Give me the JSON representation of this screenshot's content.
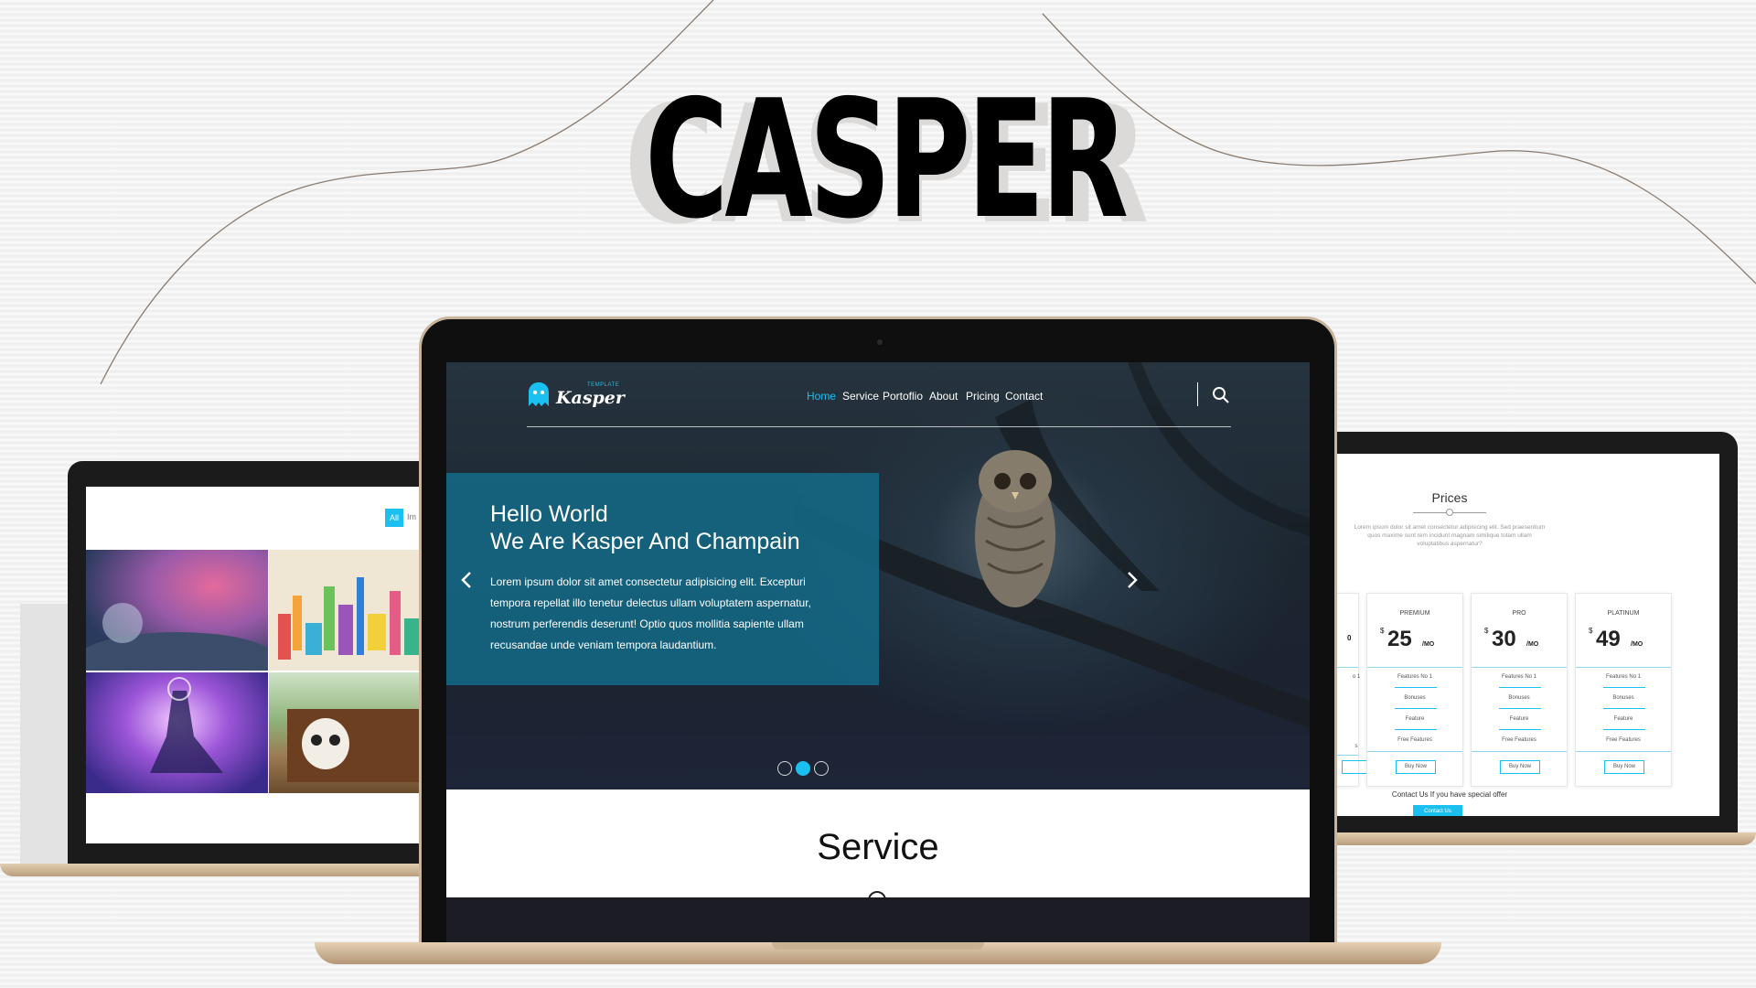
{
  "poster": {
    "title": "CASPER"
  },
  "left_screen": {
    "filter_active": "All",
    "filter_next": "Im"
  },
  "hero": {
    "logo_text": "Kasper",
    "logo_sub": "TEMPLATE",
    "nav": [
      "Home",
      "Service",
      "Portoflio",
      "About",
      "Pricing",
      "Contact"
    ],
    "heading_line1": "Hello World",
    "heading_line2": "We Are Kasper And Champain",
    "paragraph": "Lorem ipsum dolor sit amet consectetur adipisicing elit. Excepturi tempora repellat illo tenetur delectus ullam voluptatem aspernatur, nostrum perferendis deserunt! Optio quos mollitia sapiente ullam recusandae unde veniam tempora laudantium.",
    "slide_count": 3,
    "active_slide": 2,
    "next_section": "Service"
  },
  "prices": {
    "title": "Prices",
    "description": "Lorem ipsum dolor sit amet consectetur adipisicing elit. Sed praesentium quos maxime sunt rem incidunt magnam similique totam ullam voluptatibus aspernatur?",
    "partial_card": {
      "price_fragment": "0",
      "features_fragment": [
        "o 1",
        "s"
      ]
    },
    "plans": [
      {
        "name": "PREMIUM",
        "currency": "$",
        "price": "25",
        "period": "/MO",
        "features": [
          "Features No 1",
          "Bonuses",
          "Feature",
          "Free Features"
        ],
        "button": "Buy Now"
      },
      {
        "name": "PRO",
        "currency": "$",
        "price": "30",
        "period": "/MO",
        "features": [
          "Features No 1",
          "Bonuses",
          "Feature",
          "Free Features"
        ],
        "button": "Buy Now"
      },
      {
        "name": "PLATINUM",
        "currency": "$",
        "price": "49",
        "period": "/MO",
        "features": [
          "Features No 1",
          "Bonuses",
          "Feature",
          "Free Features"
        ],
        "button": "Buy Now"
      }
    ],
    "contact_text": "Contact Us If you have special offer",
    "contact_button": "Contact Us"
  },
  "colors": {
    "accent": "#19c0f0",
    "overlay": "#146e8c",
    "laptop_gold": "#c8b49c"
  }
}
